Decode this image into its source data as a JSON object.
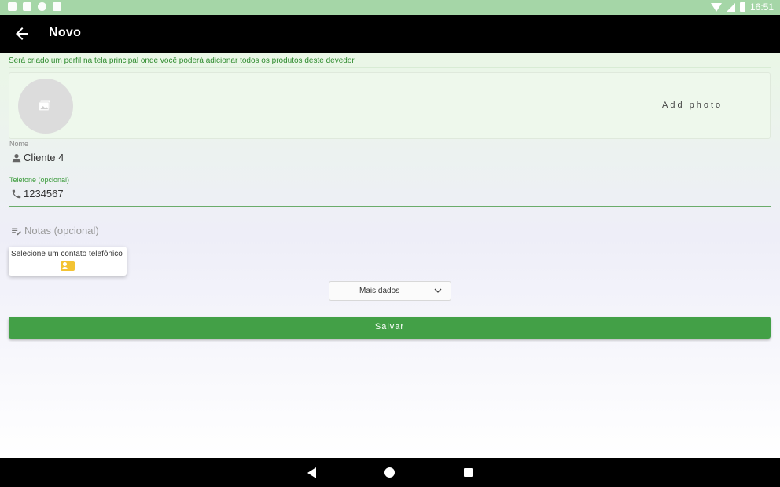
{
  "status_bar": {
    "time": "16:51"
  },
  "toolbar": {
    "title": "Novo",
    "back_icon": "arrow-back-icon"
  },
  "info": {
    "text": "Será criado um perfil na tela principal onde você poderá adicionar todos os produtos deste devedor."
  },
  "photo": {
    "add_label": "Add photo",
    "icon": "image-placeholder-icon"
  },
  "fields": {
    "name": {
      "label": "Nome",
      "value": "Cliente 4",
      "icon": "person-icon"
    },
    "phone": {
      "label": "Telefone (opcional)",
      "value": "1234567",
      "icon": "phone-icon"
    },
    "notes": {
      "placeholder": "Notas (opcional)",
      "icon": "notes-edit-icon"
    }
  },
  "contact": {
    "label": "Selecione um contato telefônico",
    "icon": "contact-card-icon"
  },
  "more": {
    "label": "Mais dados"
  },
  "save": {
    "label": "Salvar"
  },
  "colors": {
    "accent": "#43a047",
    "status_bar": "#a5d6a7",
    "toolbar": "#000000",
    "contact_icon": "#f3c333"
  }
}
